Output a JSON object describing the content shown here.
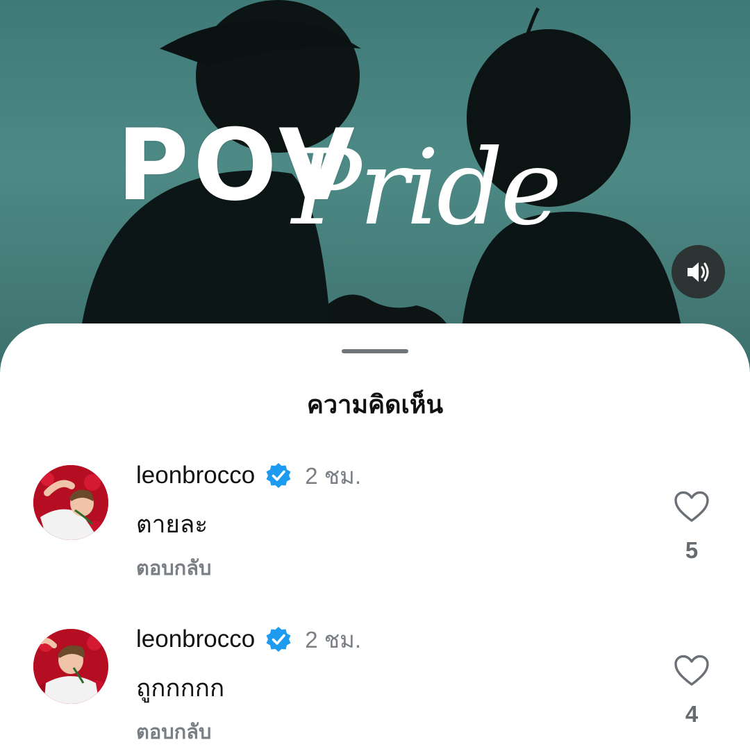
{
  "video": {
    "title_block": "POV",
    "title_script": "Pride",
    "sound_icon": "speaker-volume-icon"
  },
  "sheet": {
    "title": "ความคิดเห็น"
  },
  "comments": [
    {
      "username": "leonbrocco",
      "verified": true,
      "time": "2 ชม.",
      "text": "ตายละ",
      "reply_label": "ตอบกลับ",
      "likes": "5"
    },
    {
      "username": "leonbrocco",
      "verified": true,
      "time": "2 ชม.",
      "text": "ถูกกกกก",
      "reply_label": "ตอบกลับ",
      "likes": "4"
    }
  ],
  "colors": {
    "verified_badge": "#1d9bf0",
    "video_bg": "#4d8985"
  }
}
